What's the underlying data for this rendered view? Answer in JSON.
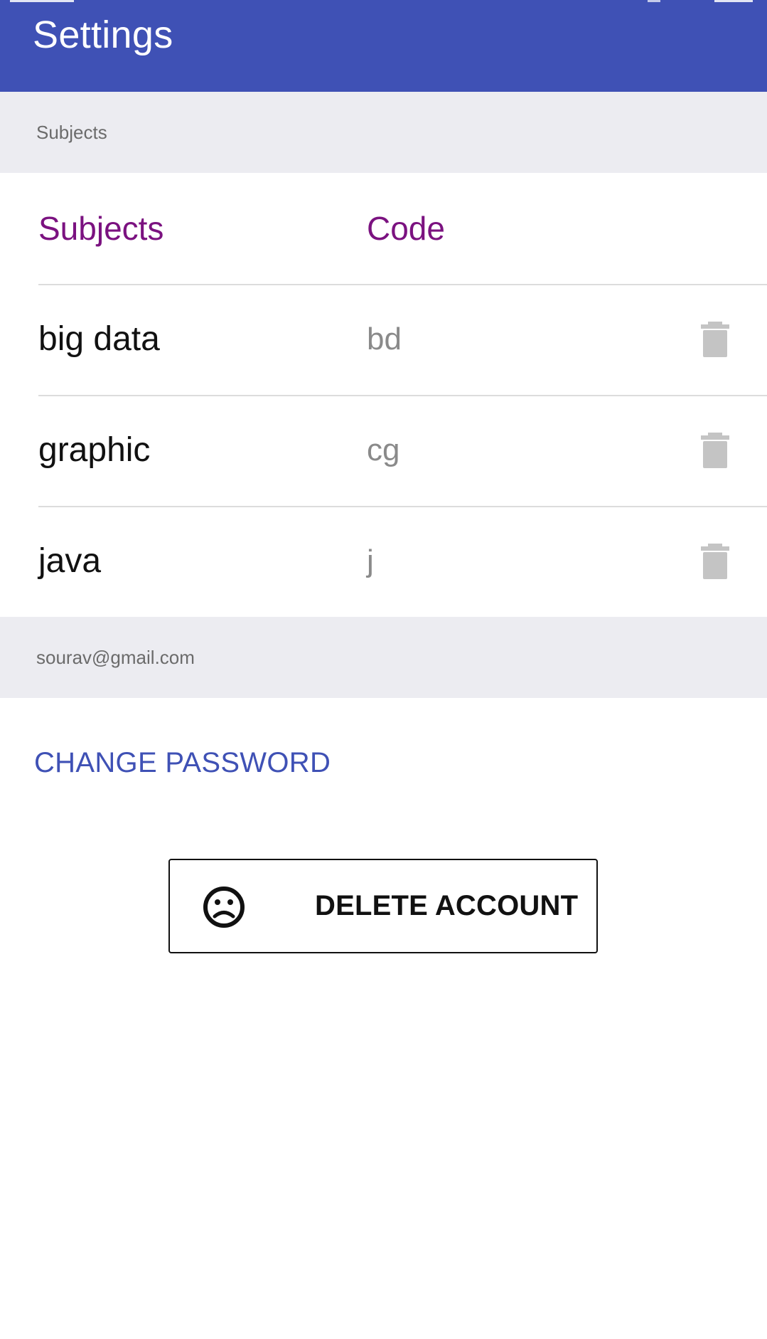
{
  "app_bar": {
    "title": "Settings",
    "color": "#3f51b5"
  },
  "subjects_section": {
    "label": "Subjects",
    "table": {
      "columns": [
        "Subjects",
        "Code"
      ],
      "rows": [
        {
          "name": "big data",
          "code": "bd",
          "action_icon": "trash-icon"
        },
        {
          "name": "graphic",
          "code": "cg",
          "action_icon": "trash-icon"
        },
        {
          "name": "java",
          "code": "j",
          "action_icon": "trash-icon"
        }
      ]
    }
  },
  "account_section": {
    "label": "sourav@gmail.com",
    "change_password_label": "CHANGE PASSWORD",
    "delete_account": {
      "label": "DELETE ACCOUNT",
      "icon": "sad-face-icon"
    }
  },
  "colors": {
    "primary": "#3f51b5",
    "column_header": "#7b1280",
    "section_background": "#ececf1",
    "icon_gray": "#c4c4c4"
  }
}
